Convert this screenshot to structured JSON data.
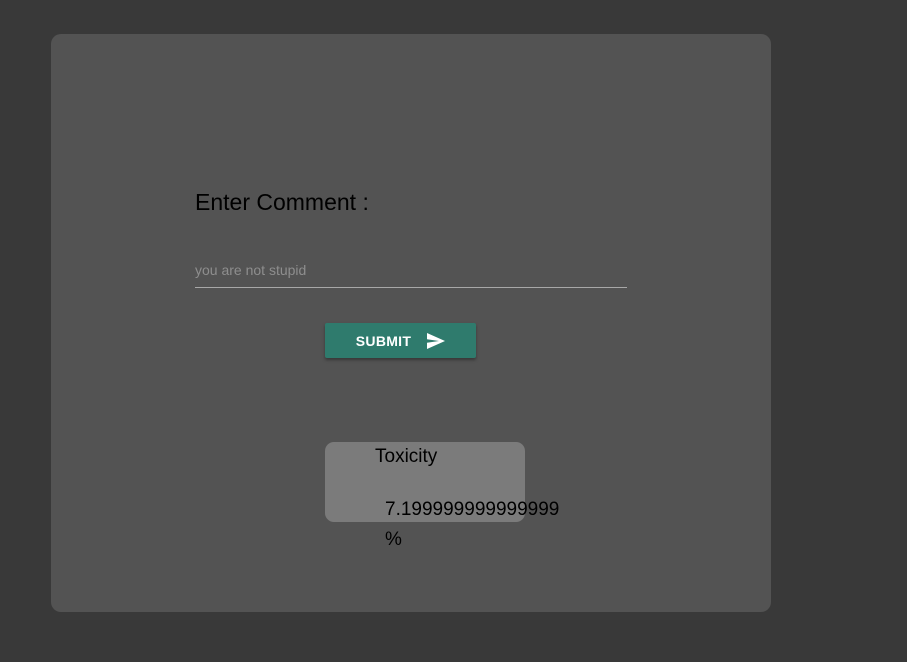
{
  "form": {
    "label": "Enter Comment :",
    "input_value": "",
    "input_placeholder": "you are not stupid",
    "submit_label": "SUBMIT"
  },
  "result": {
    "title": "Toxicity",
    "value": "7.199999999999999",
    "unit": "%"
  },
  "icons": {
    "submit": "send-icon"
  },
  "colors": {
    "background": "#393939",
    "card": "#535353",
    "accent": "#2f7b6d",
    "result_box": "#7b7b7b"
  }
}
